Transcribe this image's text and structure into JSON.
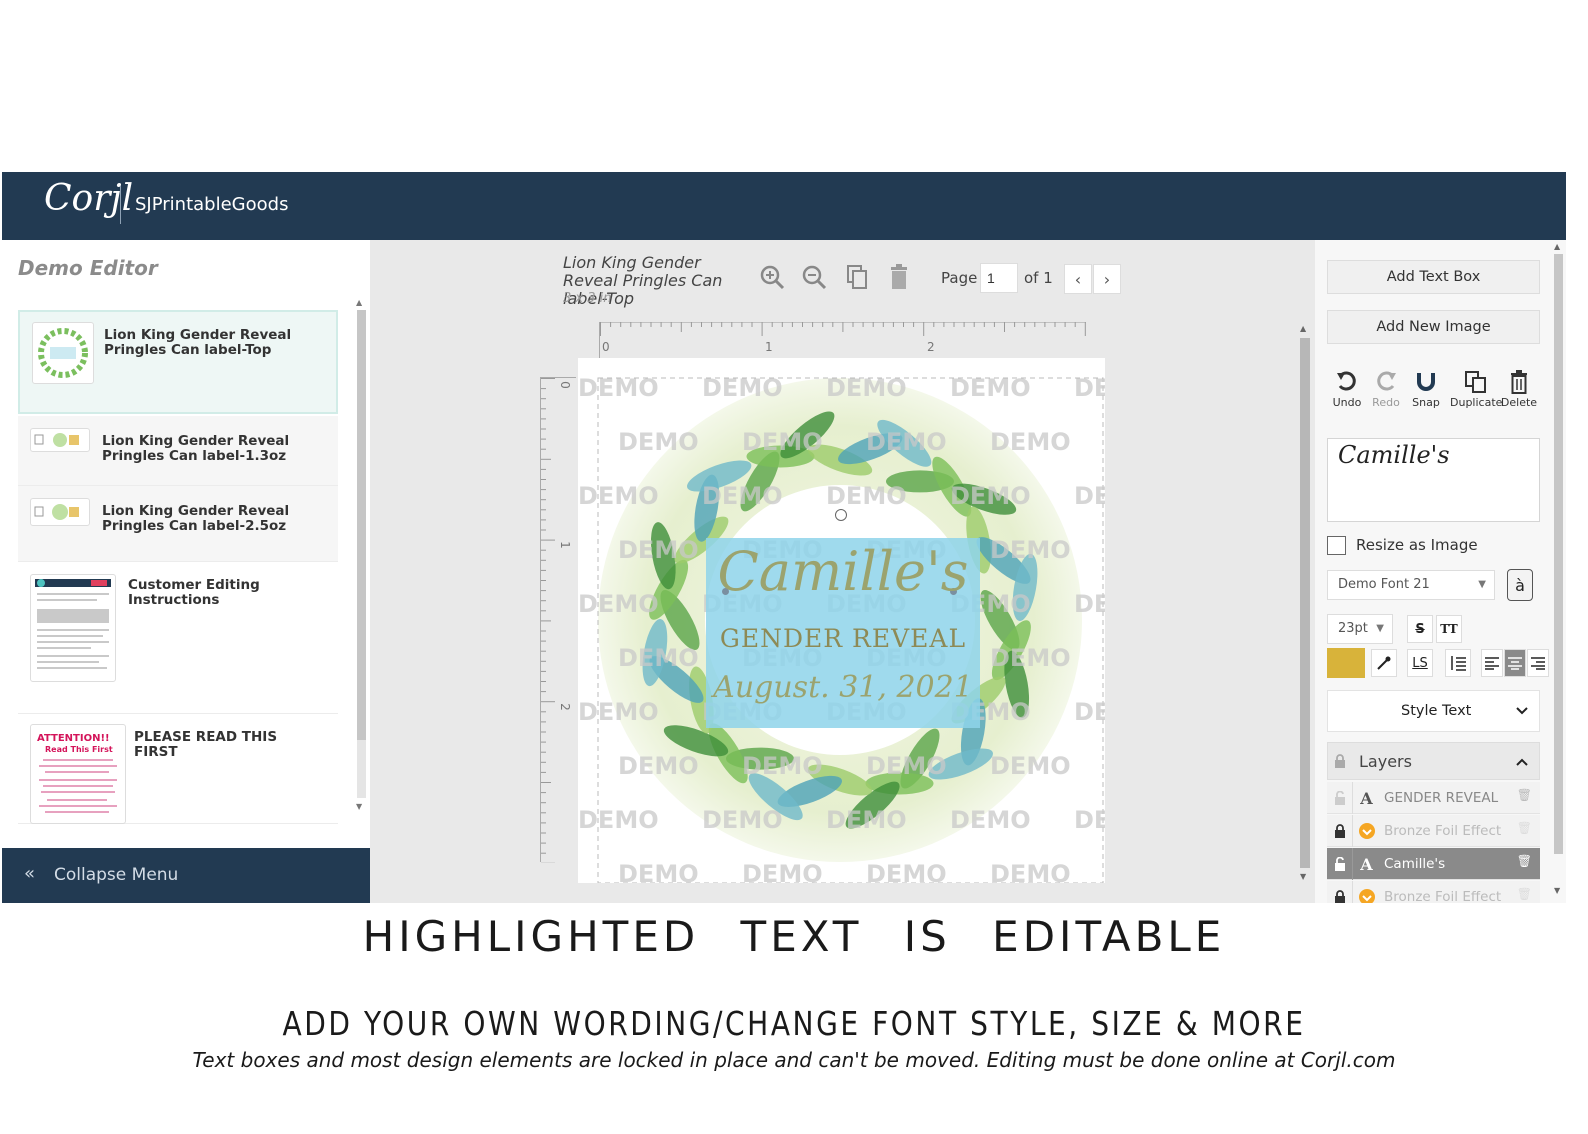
{
  "header": {
    "logo_text": "Corjl",
    "shop_name": "SJPrintableGoods"
  },
  "left_panel": {
    "title": "Demo Editor",
    "pages": [
      {
        "name": "Lion King Gender Reveal Pringles Can label-Top",
        "active": true
      },
      {
        "name": "Lion King Gender Reveal Pringles Can label-1.3oz",
        "active": false
      },
      {
        "name": "Lion King Gender Reveal Pringles Can label-2.5oz",
        "active": false
      },
      {
        "name": "Customer Editing Instructions",
        "active": false
      },
      {
        "name": "PLEASE READ THIS FIRST",
        "active": false
      }
    ],
    "attention_thumb": {
      "line1": "ATTENTION!!",
      "line2": "Read This First"
    },
    "collapse_label": "Collapse Menu"
  },
  "doc_toolbar": {
    "title": "Lion King Gender Reveal Pringles Can label-Top",
    "size": "3 x 3 in",
    "page_label": "Page",
    "page_value": "1",
    "of_label": "of 1"
  },
  "rulers": {
    "h_ticks": [
      "0",
      "1",
      "2"
    ],
    "v_ticks": [
      "0",
      "1",
      "2"
    ]
  },
  "design": {
    "watermark": "DEMO",
    "name_text": "Camille's",
    "line2": "GENDER REVEAL",
    "line3": "August. 31, 2021"
  },
  "right_panel": {
    "add_text_box": "Add Text Box",
    "add_new_image": "Add New Image",
    "tools": [
      {
        "label": "Undo",
        "icon": "undo-icon"
      },
      {
        "label": "Redo",
        "icon": "redo-icon"
      },
      {
        "label": "Snap",
        "icon": "magnet-icon"
      },
      {
        "label": "Duplicate",
        "icon": "duplicate-icon"
      },
      {
        "label": "Delete",
        "icon": "trash-icon"
      }
    ],
    "text_preview": "Camille's",
    "resize_label": "Resize as Image",
    "font_value": "Demo Font 21",
    "size_value": "23pt",
    "color_swatch": "#d8b33a",
    "style_text_label": "Style Text",
    "layers_label": "Layers",
    "layers": [
      {
        "name": "GENDER REVEAL",
        "type": "text",
        "locked": false,
        "active": false
      },
      {
        "name": "Bronze Foil Effect",
        "type": "effect",
        "locked": true,
        "active": false
      },
      {
        "name": "Camille's",
        "type": "text",
        "locked": false,
        "active": true
      },
      {
        "name": "Bronze Foil Effect",
        "type": "effect",
        "locked": true,
        "active": false
      }
    ]
  },
  "captions": {
    "headline": "HIGHLIGHTED TEXT IS EDITABLE",
    "subhead": "ADD YOUR OWN WORDING/CHANGE FONT STYLE, SIZE & MORE",
    "note": "Text boxes and most design elements are locked in place and can't be moved. Editing must be done online at Corjl.com"
  },
  "colors": {
    "header_bg": "#223a52",
    "highlight": "#8ed3ea",
    "accent_gold": "#d8b33a",
    "leaf_green": "#5aa548"
  }
}
